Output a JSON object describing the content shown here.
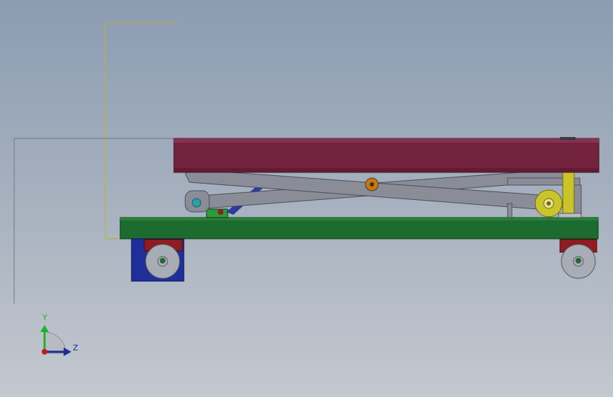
{
  "viewport": {
    "background_top": "#8b9cb2",
    "background_bottom": "#c4c8cf"
  },
  "model": {
    "platform_color": "#74233f",
    "base_frame_color": "#1d6b2e",
    "scissor_arm_color": "#8a8d98",
    "cylinder_color": "#c9c42c",
    "caster_mount_color": "#8e1c22",
    "caster_bracket_color": "#1f2f9a",
    "wheel_color": "#a8acb4",
    "pivot_pin_color": "#c0781a"
  },
  "triad": {
    "y_label": "Y",
    "z_label": "Z",
    "y_axis_color": "#22b02a",
    "z_axis_color": "#1b2f9a",
    "x_axis_color": "#c01c1c"
  },
  "sketch_lines": {
    "color_yellow": "#bdb230",
    "color_gray": "#6e7986"
  }
}
